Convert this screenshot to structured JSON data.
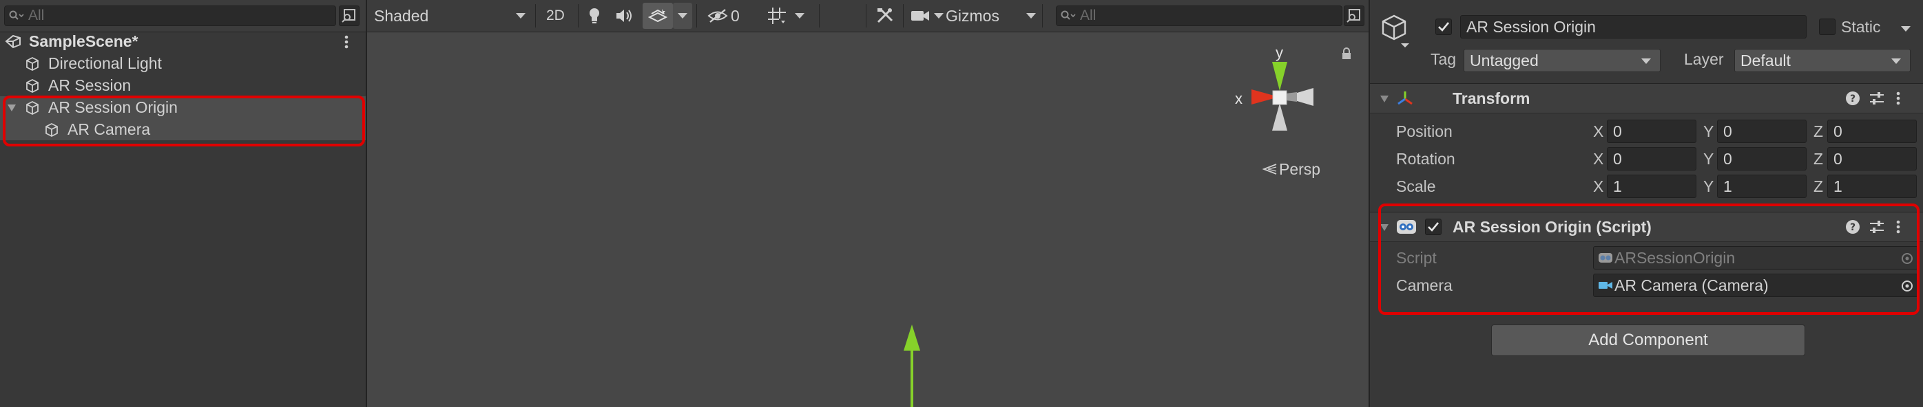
{
  "hierarchy": {
    "search_placeholder": "All",
    "scene_name": "SampleScene*",
    "items": [
      {
        "label": "Directional Light"
      },
      {
        "label": "AR Session"
      },
      {
        "label": "AR Session Origin"
      },
      {
        "label": "AR Camera"
      }
    ]
  },
  "scene": {
    "shading_mode": "Shaded",
    "mode_2d": "2D",
    "hidden_count": "0",
    "gizmos_label": "Gizmos",
    "search_placeholder": "All",
    "gizmo": {
      "y_label": "y",
      "x_label": "x",
      "persp_label": "Persp"
    }
  },
  "inspector": {
    "object_name": "AR Session Origin",
    "static_label": "Static",
    "tag_label": "Tag",
    "tag_value": "Untagged",
    "layer_label": "Layer",
    "layer_value": "Default",
    "transform": {
      "title": "Transform",
      "rows": [
        {
          "label": "Position",
          "x": "0",
          "y": "0",
          "z": "0"
        },
        {
          "label": "Rotation",
          "x": "0",
          "y": "0",
          "z": "0"
        },
        {
          "label": "Scale",
          "x": "1",
          "y": "1",
          "z": "1"
        }
      ],
      "axis_labels": {
        "x": "X",
        "y": "Y",
        "z": "Z"
      }
    },
    "script_component": {
      "title": "AR Session Origin (Script)",
      "script_label": "Script",
      "script_value": "ARSessionOrigin",
      "camera_label": "Camera",
      "camera_value": "AR Camera (Camera)"
    },
    "add_component_label": "Add Component"
  },
  "colors": {
    "highlight": "#e00000",
    "axis_y": "#86d12a",
    "axis_x": "#e0341e",
    "selection_row": "#4d4d4d"
  }
}
